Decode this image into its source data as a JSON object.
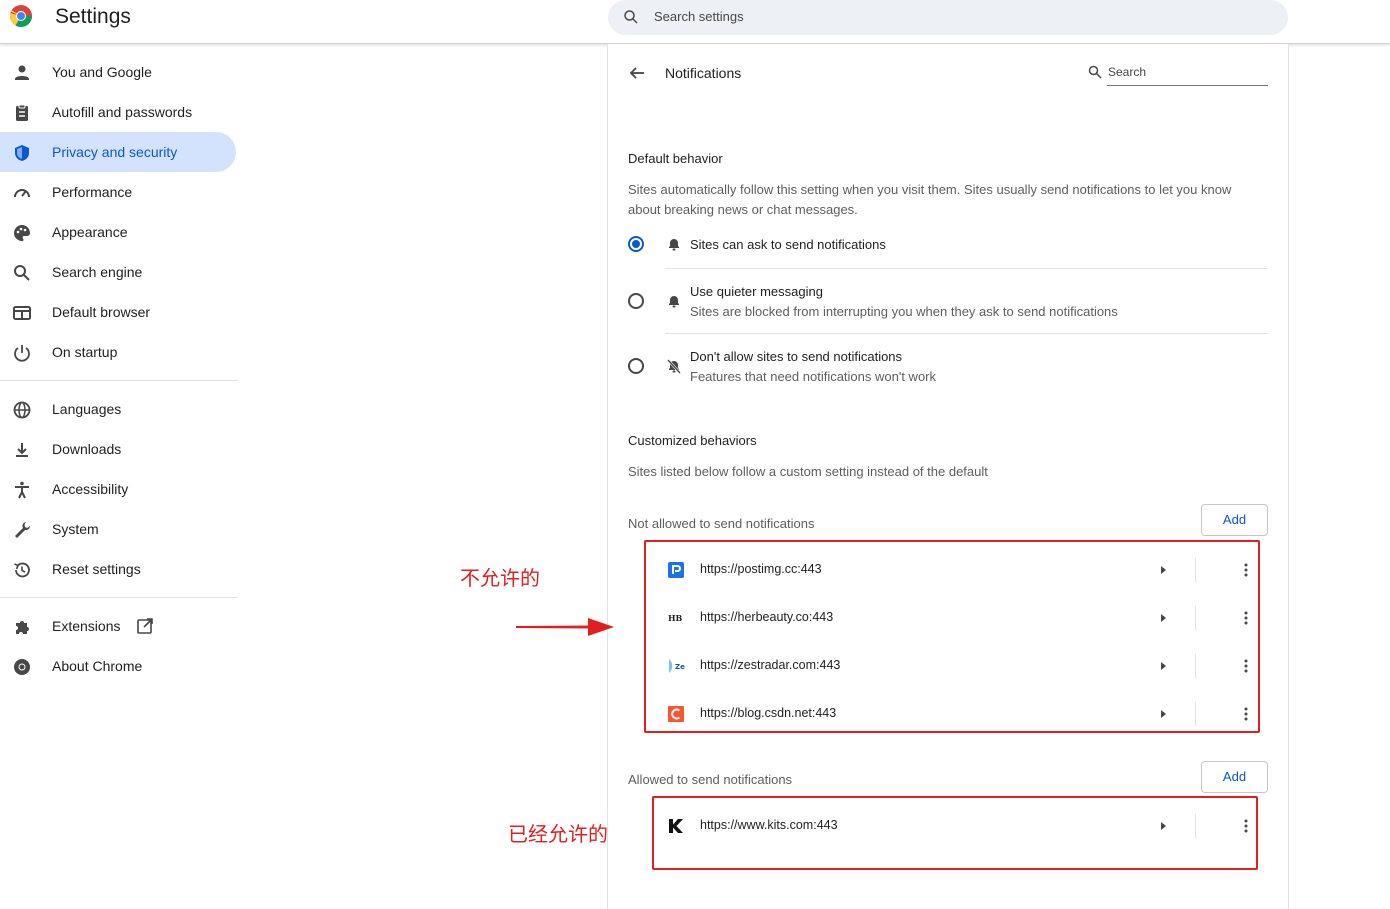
{
  "app": {
    "title": "Settings",
    "search_placeholder": "Search settings"
  },
  "sidebar": {
    "group1": [
      {
        "label": "You and Google",
        "icon": "person-icon"
      },
      {
        "label": "Autofill and passwords",
        "icon": "clipboard-icon"
      },
      {
        "label": "Privacy and security",
        "icon": "shield-icon",
        "active": true
      },
      {
        "label": "Performance",
        "icon": "gauge-icon"
      },
      {
        "label": "Appearance",
        "icon": "palette-icon"
      },
      {
        "label": "Search engine",
        "icon": "search-icon"
      },
      {
        "label": "Default browser",
        "icon": "browser-icon"
      },
      {
        "label": "On startup",
        "icon": "power-icon"
      }
    ],
    "group2": [
      {
        "label": "Languages",
        "icon": "globe-icon"
      },
      {
        "label": "Downloads",
        "icon": "download-icon"
      },
      {
        "label": "Accessibility",
        "icon": "accessibility-icon"
      },
      {
        "label": "System",
        "icon": "wrench-icon"
      },
      {
        "label": "Reset settings",
        "icon": "history-icon"
      }
    ],
    "group3": [
      {
        "label": "Extensions",
        "icon": "puzzle-icon"
      },
      {
        "label": "About Chrome",
        "icon": "chrome-icon"
      }
    ]
  },
  "panel": {
    "title": "Notifications",
    "search_label": "Search",
    "default_behavior": {
      "heading": "Default behavior",
      "description": "Sites automatically follow this setting when you visit them. Sites usually send notifications to let you know about breaking news or chat messages.",
      "options": [
        {
          "label": "Sites can ask to send notifications",
          "sub": "",
          "checked": true,
          "icon": "bell-icon"
        },
        {
          "label": "Use quieter messaging",
          "sub": "Sites are blocked from interrupting you when they ask to send notifications",
          "checked": false,
          "icon": "bell-icon"
        },
        {
          "label": "Don't allow sites to send notifications",
          "sub": "Features that need notifications won't work",
          "checked": false,
          "icon": "bell-off-icon"
        }
      ]
    },
    "customized": {
      "heading": "Customized behaviors",
      "description": "Sites listed below follow a custom setting instead of the default"
    },
    "not_allowed": {
      "label": "Not allowed to send notifications",
      "add_label": "Add",
      "sites": [
        {
          "url": "https://postimg.cc:443",
          "favicon": "postimg-favicon"
        },
        {
          "url": "https://herbeauty.co:443",
          "favicon": "herbeauty-favicon"
        },
        {
          "url": "https://zestradar.com:443",
          "favicon": "zestradar-favicon"
        },
        {
          "url": "https://blog.csdn.net:443",
          "favicon": "csdn-favicon"
        }
      ]
    },
    "allowed": {
      "label": "Allowed to send notifications",
      "add_label": "Add",
      "sites": [
        {
          "url": "https://www.kits.com:443",
          "favicon": "kits-favicon"
        }
      ]
    }
  },
  "annotations": {
    "not_allowed_note": "不允许的",
    "allowed_note": "已经允许的",
    "color": "#e0201f"
  },
  "colors": {
    "accent": "#0b57d0",
    "active_bg": "#d3e3fd"
  }
}
